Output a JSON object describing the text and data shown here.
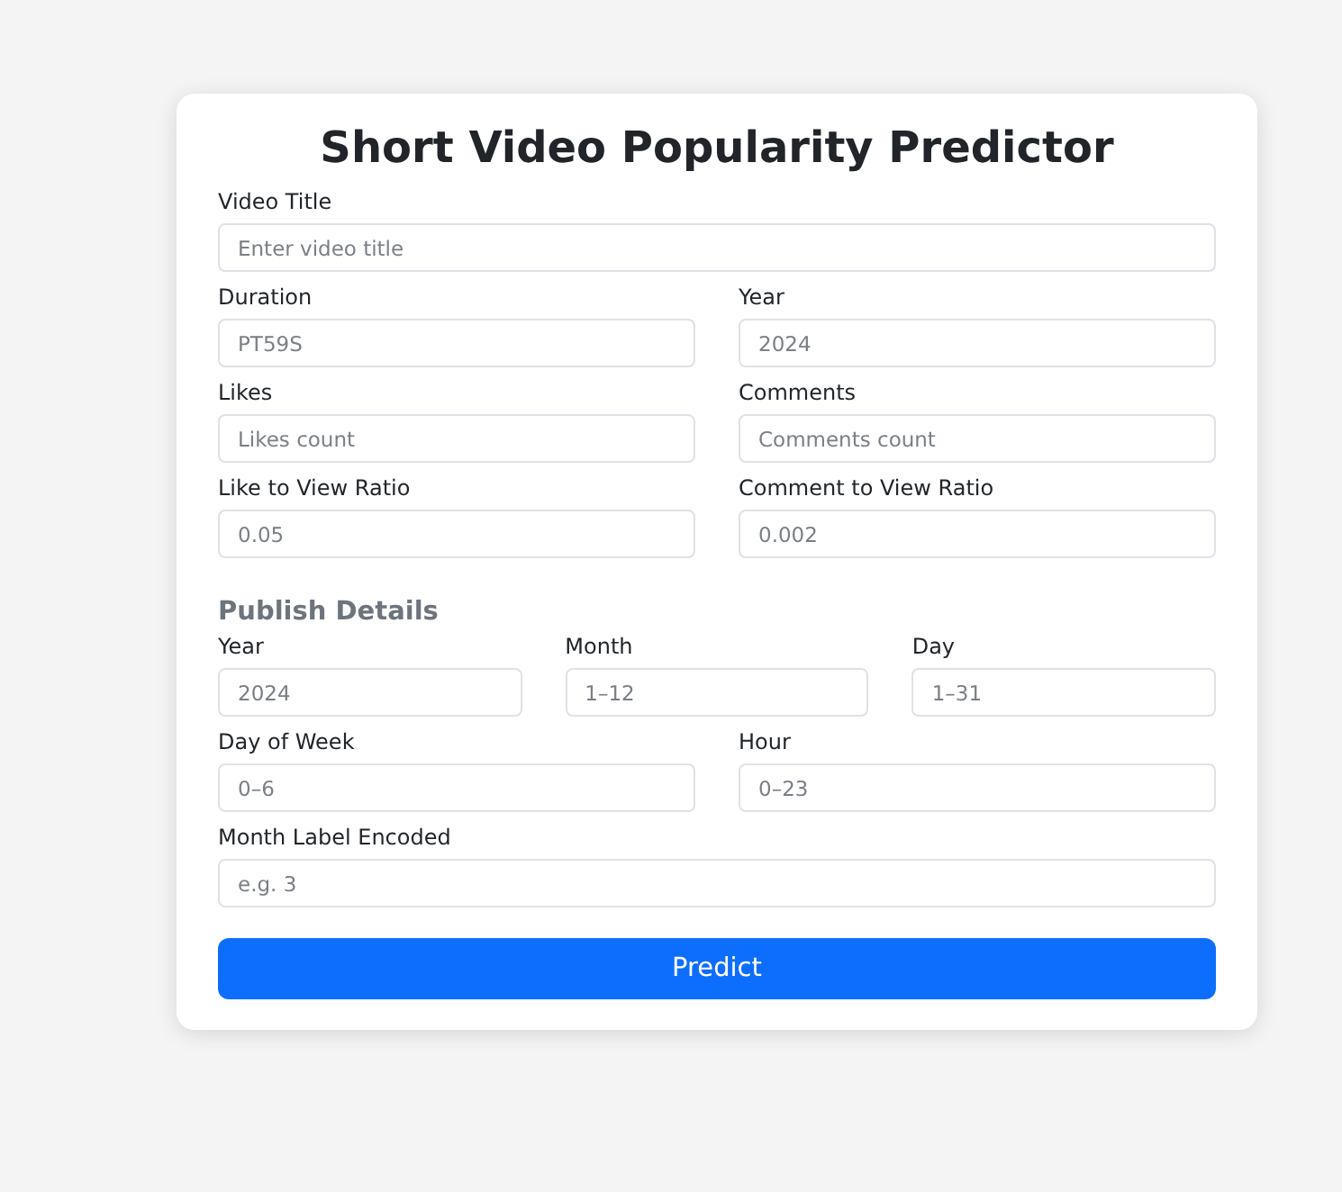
{
  "title": "Short Video Popularity Predictor",
  "sections": [
    {
      "rows": [
        [
          {
            "label": "Video Title",
            "placeholder": "Enter video title"
          }
        ],
        [
          {
            "label": "Duration",
            "placeholder": "PT59S"
          },
          {
            "label": "Year",
            "placeholder": "2024"
          }
        ],
        [
          {
            "label": "Likes",
            "placeholder": "Likes count"
          },
          {
            "label": "Comments",
            "placeholder": "Comments count"
          }
        ],
        [
          {
            "label": "Like to View Ratio",
            "placeholder": "0.05"
          },
          {
            "label": "Comment to View Ratio",
            "placeholder": "0.002"
          }
        ]
      ]
    },
    {
      "heading": "Publish Details",
      "rows": [
        [
          {
            "label": "Year",
            "placeholder": "2024"
          },
          {
            "label": "Month",
            "placeholder": "1–12"
          },
          {
            "label": "Day",
            "placeholder": "1–31"
          }
        ],
        [
          {
            "label": "Day of Week",
            "placeholder": "0–6"
          },
          {
            "label": "Hour",
            "placeholder": "0–23"
          }
        ],
        [
          {
            "label": "Month Label Encoded",
            "placeholder": "e.g. 3"
          }
        ]
      ]
    }
  ],
  "button": "Predict"
}
